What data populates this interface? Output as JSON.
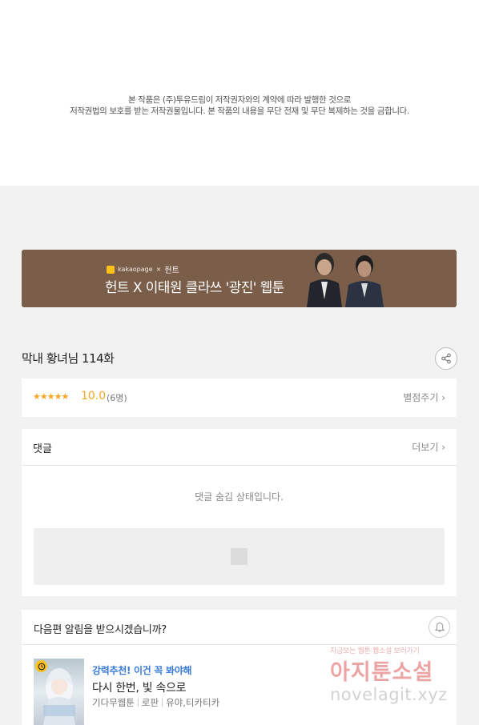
{
  "notice": {
    "line1": "본 작품은 (주)투유드림이 저작권자와의 계약에 따라 발행한 것으로",
    "line2": "저작권법의 보호를 받는 저작권물입니다. 본 작품의 내용을 무단 전재 및 무단 복제하는 것을 금합니다."
  },
  "banner": {
    "brand": "kakaopage",
    "cross": "×",
    "partner": "헌트",
    "title": "헌트 X 이태원 클라쓰 '광진' 웹툰"
  },
  "episode": {
    "title": "막내 황녀님 114화",
    "share_icon": "share-icon"
  },
  "rating": {
    "stars": "★★★★★",
    "score": "10.0",
    "count": "(6명)",
    "rate_label": "별점주기 ›",
    "star_color": "#f5a623"
  },
  "comments": {
    "title": "댓글",
    "more_label": "더보기 ›",
    "hidden_message": "댓글 숨김 상태입니다."
  },
  "next_episode": {
    "prompt": "다음편 알림을 받으시겠습니까?",
    "bell_icon": "bell-icon"
  },
  "recommendation": {
    "label": "강력추천! 이건 꼭 봐야해",
    "title": "다시 한번, 빛 속으로",
    "meta": [
      "기다무웹툰",
      "로판",
      "유야,티카티카"
    ],
    "label_color": "#3a7bd5"
  },
  "watermark": {
    "small": "지금보는 웹툰 웹소설 보러가기",
    "big": "아지툰소설",
    "url": "novelagit.xyz"
  },
  "colors": {
    "page_bg": "#f2f2f2",
    "banner_bg": "#7a5e4a",
    "kakao_yellow": "#ffc21a"
  }
}
